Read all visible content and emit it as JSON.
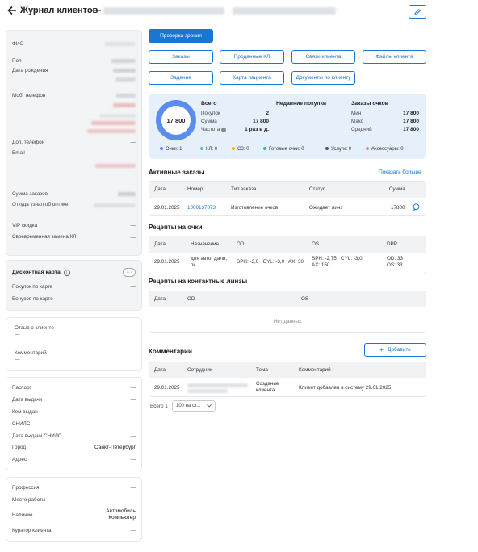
{
  "header": {
    "title": "Журнал клиентов",
    "separator": "—"
  },
  "client": {
    "fields": [
      {
        "label": "ФИО"
      },
      {
        "label": "Пол"
      },
      {
        "label": "Дата рождения"
      },
      {
        "label": "Моб. телефон"
      },
      {
        "label": "Доп. телефон",
        "value": "—"
      },
      {
        "label": "Email",
        "value": "—"
      }
    ],
    "stats": [
      {
        "label": "Сумма заказов"
      },
      {
        "label": "Откуда узнал об оптике"
      },
      {
        "label": "VIP скидка",
        "value": "—"
      },
      {
        "label": "Своевременная замена КЛ",
        "value": "—"
      }
    ]
  },
  "discount": {
    "title": "Дисконтная карта",
    "info_icon": "info-icon",
    "more_icon": "ellipsis-icon",
    "rows": [
      {
        "label": "Покупок по карте",
        "value": "—"
      },
      {
        "label": "Бонусов по карте",
        "value": "—"
      }
    ]
  },
  "feedback": {
    "review_label": "Отзыв о клиенте",
    "review_value": "—",
    "comment_label": "Комментарий",
    "comment_value": "—"
  },
  "documents": [
    {
      "label": "Паспорт",
      "value": "—"
    },
    {
      "label": "Дата выдачи",
      "value": "—"
    },
    {
      "label": "Кем выдан",
      "value": "—"
    },
    {
      "label": "СНИЛС",
      "value": "—"
    },
    {
      "label": "Дата выдачи СНИЛС",
      "value": "—"
    },
    {
      "label": "Город",
      "value": "Санкт-Петербург"
    },
    {
      "label": "Адрес",
      "value": "—"
    }
  ],
  "extra": {
    "profession": {
      "label": "Профессия",
      "value": "—"
    },
    "workplace": {
      "label": "Место работы",
      "value": "—"
    },
    "availability": {
      "label": "Наличие",
      "value1": "Автомобиль",
      "value2": "Компьютер"
    },
    "curator": {
      "label": "Куратор клиента",
      "value": "—"
    }
  },
  "actions": {
    "vision_check": "Проверка зрения",
    "buttons": [
      "Заказы",
      "Проданные КЛ",
      "Связи клиента",
      "Файлы клиента",
      "Задание",
      "Карта пациента",
      "Документы по клиенту"
    ]
  },
  "summary": {
    "ring_value": "17 800",
    "total": {
      "title": "Всего",
      "rows": [
        {
          "label": "Покупок",
          "value": "2"
        },
        {
          "label": "Сумма",
          "value": "17 800"
        },
        {
          "label": "Частота",
          "value": "1 раз в д."
        }
      ]
    },
    "recent_title": "Недавние покупки",
    "glasses": {
      "title": "Заказы очков",
      "rows": [
        {
          "label": "Мин",
          "value": "17 800"
        },
        {
          "label": "Макс",
          "value": "17 800"
        },
        {
          "label": "Средний",
          "value": "17 800"
        }
      ]
    },
    "legend": [
      {
        "label": "Очки: 1",
        "color": "#5b8def"
      },
      {
        "label": "КЛ: 0",
        "color": "#4fc3c7"
      },
      {
        "label": "СЗ: 0",
        "color": "#f0b400"
      },
      {
        "label": "Готовые очки: 0",
        "color": "#2bbf8a"
      },
      {
        "label": "Услуги: 0",
        "color": "#555555"
      },
      {
        "label": "Аксессуары: 0",
        "color": "#ef7fa8"
      }
    ]
  },
  "active_orders": {
    "title": "Активные заказы",
    "show_more": "Показать больше",
    "headers": [
      "Дата",
      "Номер",
      "Тип заказа",
      "Статус",
      "Сумма"
    ],
    "rows": [
      {
        "date": "29.01.2025",
        "number": "1000137073",
        "type": "Изготовление очков",
        "status": "Ожидает линз",
        "sum": "17800"
      }
    ]
  },
  "glasses_prescriptions": {
    "title": "Рецепты на очки",
    "headers": [
      "Дата",
      "Назначение",
      "OD",
      "OS",
      "DPP"
    ],
    "rows": [
      {
        "date": "29.01.2025",
        "purpose1": "для авто, дали,",
        "purpose2": "пк",
        "od": "SPH: -3,0   CYL: -3,0   AX: 30",
        "os1": "SPH: -2,75   CYL: -3,0",
        "os2": "AX: 150",
        "dpp1": "OD: 33",
        "dpp2": "OS: 33"
      }
    ]
  },
  "lens_prescriptions": {
    "title": "Рецепты на контактные линзы",
    "headers": [
      "Дата",
      "OD",
      "OS"
    ],
    "empty": "Нет данных"
  },
  "comments": {
    "title": "Комментарии",
    "add_button": "Добавить",
    "headers": [
      "Дата",
      "Сотрудник",
      "Тема",
      "Комментарий"
    ],
    "rows": [
      {
        "date": "29.01.2025",
        "topic1": "Создание",
        "topic2": "клиента",
        "comment": "Клиент добавлен в систему 29.01.2025"
      }
    ]
  },
  "pagination": {
    "total": "Всего 1",
    "per_page": "100 на ст..."
  }
}
